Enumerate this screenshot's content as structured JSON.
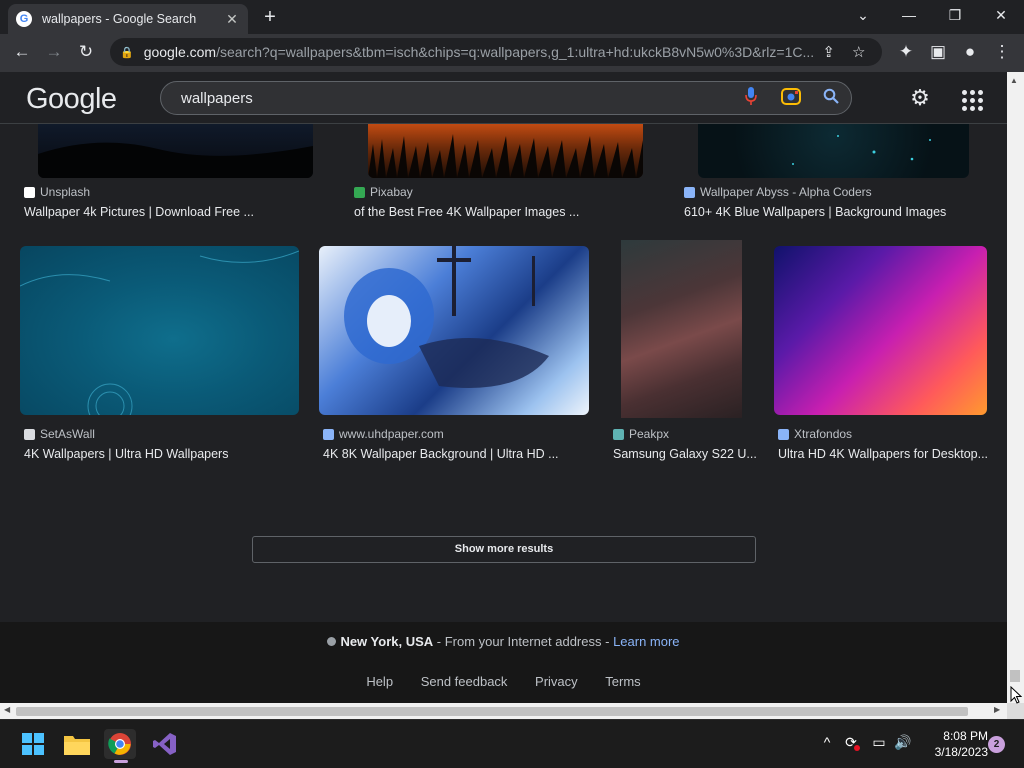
{
  "browser": {
    "tab_title": "wallpapers - Google Search",
    "tab_close": "✕",
    "new_tab": "+",
    "url_host": "google.com",
    "url_rest": "/search?q=wallpapers&tbm=isch&chips=q:wallpapers,g_1:ultra+hd:ukckB8vN5w0%3D&rlz=1C..."
  },
  "google": {
    "logo": "Google",
    "query": "wallpapers"
  },
  "results": [
    {
      "source": "Unsplash",
      "caption": "Wallpaper 4k Pictures | Download Free ...",
      "fav_color": "#ffffff"
    },
    {
      "source": "Pixabay",
      "caption": "of the Best Free 4K Wallpaper Images ...",
      "fav_color": "#34a853"
    },
    {
      "source": "Wallpaper Abyss - Alpha Coders",
      "caption": "610+ 4K Blue Wallpapers | Background Images",
      "fav_color": "#8ab4f8"
    },
    {
      "source": "SetAsWall",
      "caption": "4K Wallpapers | Ultra HD Wallpapers",
      "fav_color": "#dadce0"
    },
    {
      "source": "www.uhdpaper.com",
      "caption": "4K 8K Wallpaper Background | Ultra HD ...",
      "fav_color": "#8ab4f8"
    },
    {
      "source": "Peakpx",
      "caption": "Samsung Galaxy S22 U...",
      "fav_color": "#5fb3b3"
    },
    {
      "source": "Xtrafondos",
      "caption": "Ultra HD 4K Wallpapers for Desktop...",
      "fav_color": "#8ab4f8"
    }
  ],
  "show_more": "Show more results",
  "footer": {
    "location": "New York, USA",
    "location_suffix": " - From your Internet address - ",
    "learn_more": "Learn more",
    "links": [
      "Help",
      "Send feedback",
      "Privacy",
      "Terms"
    ]
  },
  "taskbar": {
    "time": "8:08 PM",
    "date": "3/18/2023",
    "notifications": "2"
  }
}
